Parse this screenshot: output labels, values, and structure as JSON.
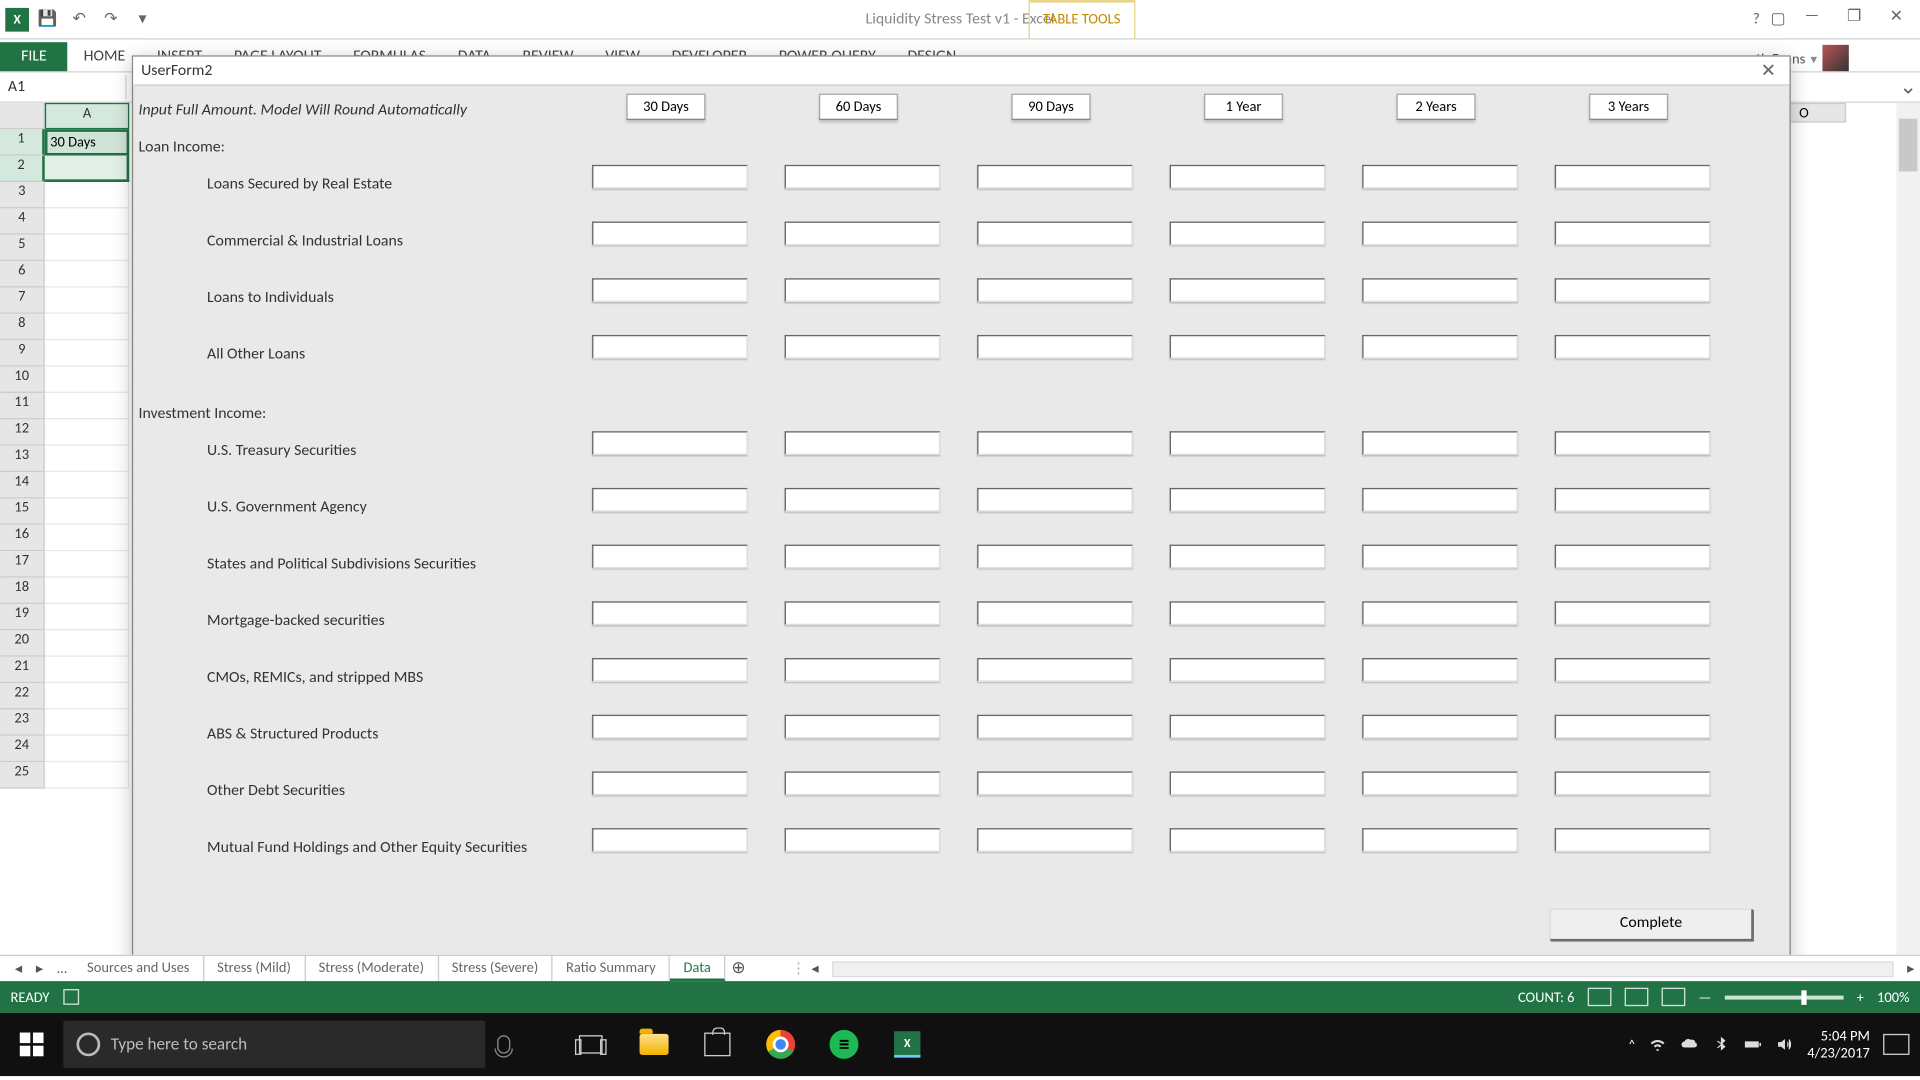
{
  "app": {
    "title": "Liquidity Stress Test v1 - Excel",
    "contextTab": "TABLE TOOLS",
    "user": "th Evans"
  },
  "qat": {
    "undo": "↶",
    "redo": "↷"
  },
  "ribbon": {
    "file": "FILE",
    "tabs": [
      "HOME",
      "INSERT",
      "PAGE LAYOUT",
      "FORMULAS",
      "DATA",
      "REVIEW",
      "VIEW",
      "DEVELOPER",
      "POWER QUERY",
      "DESIGN"
    ]
  },
  "nameBox": "A1",
  "cellA1": "30 Days",
  "columnA": "A",
  "columnO": "O",
  "userform": {
    "title": "UserForm2",
    "hint": "Input Full Amount. Model Will Round Automatically",
    "periods": [
      "30 Days",
      "60 Days",
      "90 Days",
      "1 Year",
      "2 Years",
      "3 Years"
    ],
    "loanHeader": "Loan Income:",
    "loanItems": [
      "Loans Secured by Real Estate",
      "Commercial & Industrial Loans",
      "Loans to Individuals",
      "All Other Loans"
    ],
    "invHeader": "Investment Income:",
    "invItems": [
      "U.S. Treasury Securities",
      "U.S. Government Agency",
      "States and Political Subdivisions Securities",
      "Mortgage-backed securities",
      "CMOs, REMICs, and stripped MBS",
      "ABS & Structured Products",
      "Other Debt Securities",
      "Mutual Fund Holdings and Other Equity Securities"
    ],
    "complete": "Complete"
  },
  "sheetTabs": [
    "Sources and Uses",
    "Stress (Mild)",
    "Stress (Moderate)",
    "Stress (Severe)",
    "Ratio Summary",
    "Data"
  ],
  "activeSheet": "Data",
  "status": {
    "ready": "READY",
    "count": "COUNT: 6",
    "zoom": "100%"
  },
  "taskbar": {
    "searchPlaceholder": "Type here to search",
    "time": "5:04 PM",
    "date": "4/23/2017"
  }
}
